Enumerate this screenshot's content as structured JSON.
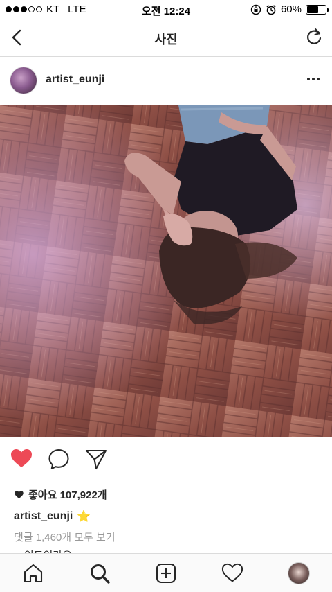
{
  "status_bar": {
    "carrier": "KT",
    "network": "LTE",
    "time": "오전 12:24",
    "battery": "60%",
    "battery_level": 0.6,
    "signal_full": 3,
    "signal_total": 5
  },
  "nav": {
    "title": "사진"
  },
  "post": {
    "username": "artist_eunji",
    "likes_label": "좋아요 107,922개",
    "caption_username": "artist_eunji",
    "caption_emoji": "⭐",
    "comments_link": "댓글 1,460개 모두 보기",
    "partial_comment": "···이드이라요"
  },
  "colors": {
    "heart_liked": "#ed4956",
    "text": "#262626",
    "muted": "#999999",
    "divider": "#dbdbdb"
  },
  "icons": {
    "back": "chevron-left-icon",
    "refresh": "refresh-icon",
    "more": "more-horizontal-icon",
    "like": "heart-filled-icon",
    "comment": "comment-bubble-icon",
    "share": "paper-plane-icon",
    "home": "home-icon",
    "search": "search-icon",
    "add": "add-square-icon",
    "activity": "heart-outline-icon"
  }
}
